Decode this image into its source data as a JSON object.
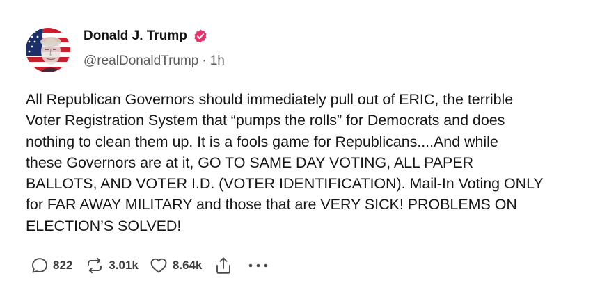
{
  "post": {
    "author": {
      "display_name": "Donald J. Trump",
      "handle": "@realDonaldTrump",
      "verified": true,
      "avatar_icon": "profile-avatar-flag-icon"
    },
    "separator": "·",
    "time_ago": "1h",
    "text": "All Republican Governors should immediately pull out of ERIC, the terrible\nVoter Registration System that “pumps the rolls” for Democrats and does\nnothing to clean them up. It is a fools game for Republicans....And while\nthese Governors are at it, GO TO SAME DAY VOTING, ALL PAPER\nBALLOTS, AND VOTER I.D. (VOTER IDENTIFICATION). Mail-In Voting ONLY\nfor FAR AWAY MILITARY and those that are VERY SICK! PROBLEMS ON\nELECTION’S SOLVED!",
    "actions": {
      "reply_count": "822",
      "retruth_count": "3.01k",
      "like_count": "8.64k"
    }
  },
  "icons": {
    "verified": "verified-badge-icon",
    "reply": "reply-icon",
    "retruth": "retruth-icon",
    "like": "heart-icon",
    "share": "share-icon",
    "more": "more-icon"
  },
  "colors": {
    "verified_badge": "#e9326a",
    "text": "#161616",
    "secondary_text": "#5a5a5a",
    "icon": "#4a4a4a"
  }
}
